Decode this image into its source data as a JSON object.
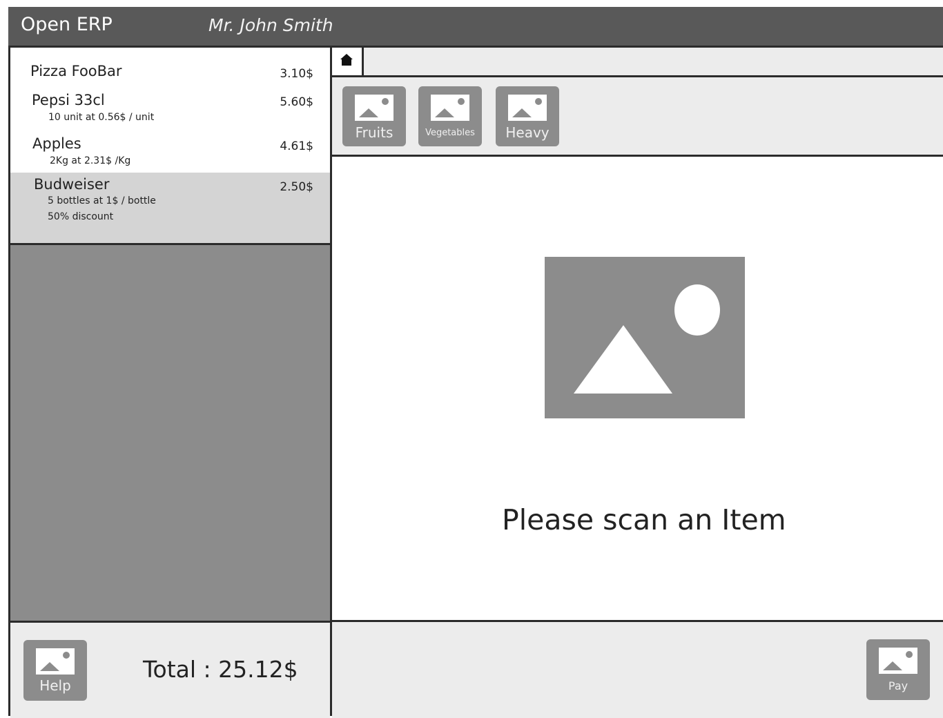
{
  "header": {
    "app_title": "Open ERP",
    "user_name": "Mr. John Smith"
  },
  "order": {
    "lines": [
      {
        "name": "Pizza FooBar",
        "price": "3.10$",
        "details": []
      },
      {
        "name": "Pepsi 33cl",
        "price": "5.60$",
        "details": [
          "10 unit at 0.56$ / unit"
        ]
      },
      {
        "name": "Apples",
        "price": "4.61$",
        "details": [
          "2Kg at 2.31$ /Kg"
        ]
      },
      {
        "name": "Budweiser",
        "price": "2.50$",
        "details": [
          "5 bottles at 1$ / bottle",
          "50% discount"
        ],
        "selected": true
      }
    ],
    "total": "Total : 25.12$"
  },
  "navigation": {
    "home_icon": "home-icon"
  },
  "categories": [
    {
      "label": "Fruits",
      "icon": "image-icon"
    },
    {
      "label": "Vegetables",
      "icon": "image-icon"
    },
    {
      "label": "Heavy",
      "icon": "image-icon"
    }
  ],
  "scan": {
    "message": "Please scan an Item",
    "icon": "image-placeholder"
  },
  "actions": {
    "help_label": "Help",
    "pay_label": "Pay"
  },
  "colors": {
    "header_bg": "#595959",
    "panel_bg": "#8c8c8c",
    "toolbar_bg": "#ececec",
    "selected_bg": "#d4d4d4",
    "border": "#2b2b2b"
  }
}
